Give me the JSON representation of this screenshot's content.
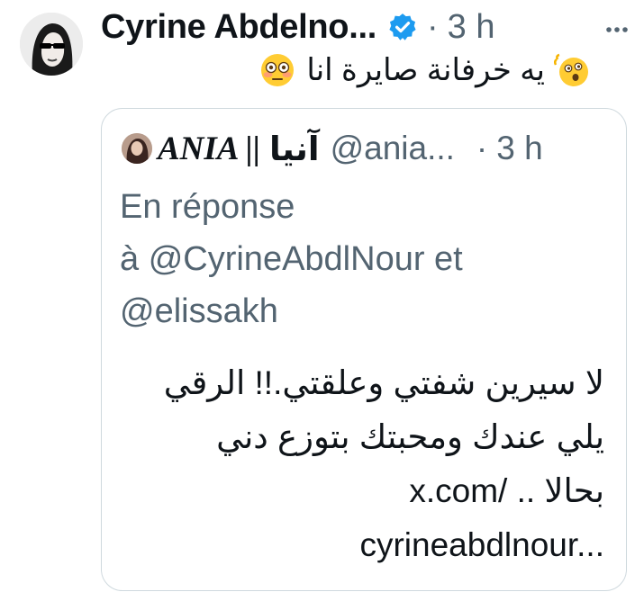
{
  "tweet": {
    "display_name": "Cyrine Abdelno...",
    "separator": "·",
    "time": "3 h",
    "text": "يه خرفانة صايرة انا",
    "verified_icon": "verified-badge-icon",
    "more_icon": "more-options-icon",
    "emoji_left": "flushed-face-emoji",
    "emoji_right": "dizzy-face-emoji"
  },
  "quote": {
    "display_name": "ANIA || آنيا",
    "display_name_latin": "ANIA ||",
    "display_name_arabic": "آنيا",
    "handle": "@ania...",
    "separator": "·",
    "time": "3 h",
    "reply_lines": [
      "En réponse",
      "à @CyrineAbdlNour et",
      "@elissakh"
    ],
    "body_lines": [
      "لا سيرين شفتي وعلقتي.!! الرقي",
      "يلي عندك ومحبتك بتوزع دني",
      "بحالا .. /x.com",
      "cyrineabdlnour..."
    ]
  },
  "colors": {
    "text": "#0f1419",
    "secondary": "#536471",
    "verified": "#1d9bf0",
    "border": "#cfd9de"
  }
}
